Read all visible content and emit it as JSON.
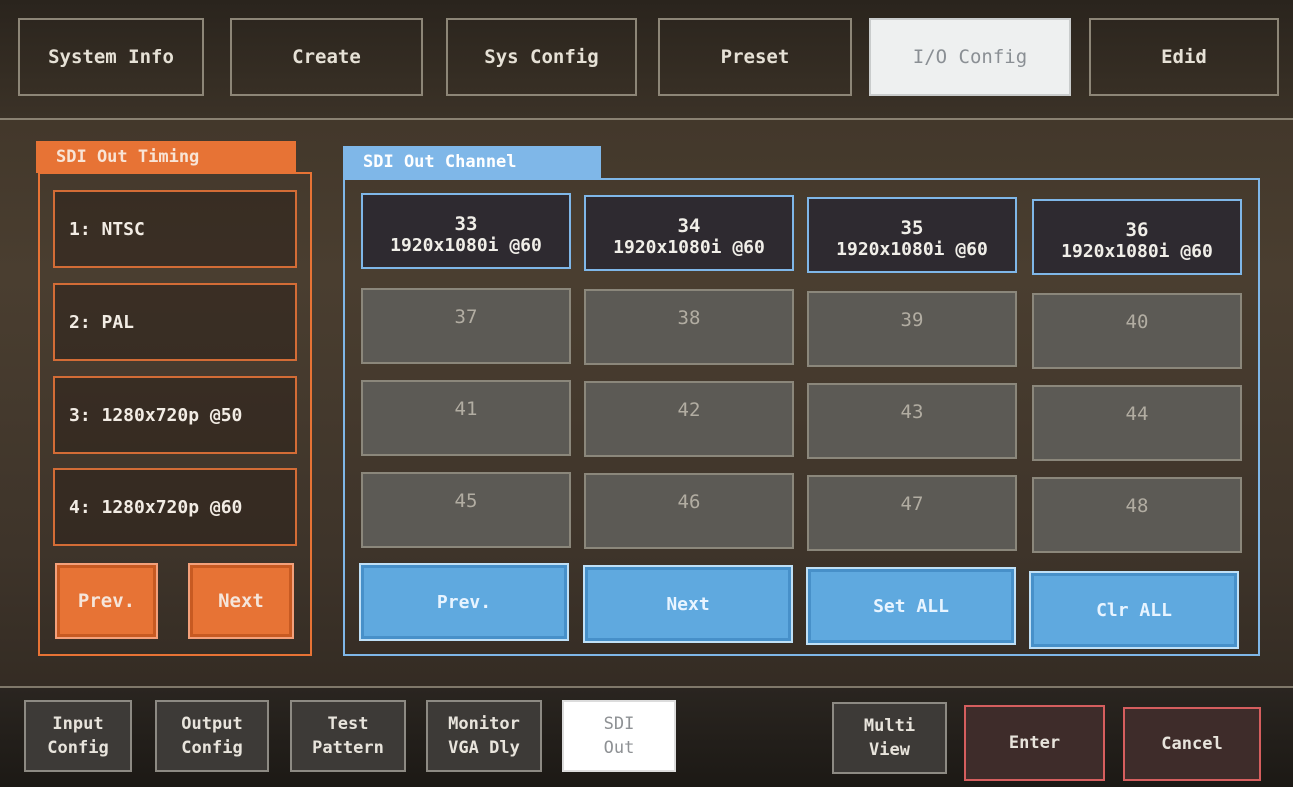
{
  "top_tabs": [
    {
      "label": "System Info"
    },
    {
      "label": "Create"
    },
    {
      "label": "Sys Config"
    },
    {
      "label": "Preset"
    },
    {
      "label": "I/O Config",
      "active": true
    },
    {
      "label": "Edid"
    }
  ],
  "sdi_out_timing": {
    "title": "SDI Out Timing",
    "items": [
      {
        "label": "1: NTSC"
      },
      {
        "label": "2: PAL"
      },
      {
        "label": "3: 1280x720p @50"
      },
      {
        "label": "4: 1280x720p @60"
      }
    ],
    "prev_label": "Prev.",
    "next_label": "Next"
  },
  "sdi_out_channel": {
    "title": "SDI Out Channel",
    "channels": [
      {
        "num": "33",
        "res": "1920x1080i @60"
      },
      {
        "num": "34",
        "res": "1920x1080i @60"
      },
      {
        "num": "35",
        "res": "1920x1080i @60"
      },
      {
        "num": "36",
        "res": "1920x1080i @60"
      },
      {
        "num": "37"
      },
      {
        "num": "38"
      },
      {
        "num": "39"
      },
      {
        "num": "40"
      },
      {
        "num": "41"
      },
      {
        "num": "42"
      },
      {
        "num": "43"
      },
      {
        "num": "44"
      },
      {
        "num": "45"
      },
      {
        "num": "46"
      },
      {
        "num": "47"
      },
      {
        "num": "48"
      }
    ],
    "buttons": {
      "prev_label": "Prev.",
      "next_label": "Next",
      "set_all_label": "Set ALL",
      "clr_all_label": "Clr ALL"
    }
  },
  "bottom_bar": {
    "input_config": [
      "Input",
      "Config"
    ],
    "output_config": [
      "Output",
      "Config"
    ],
    "test_pattern": [
      "Test",
      "Pattern"
    ],
    "monitor_vga": [
      "Monitor",
      "VGA Dly"
    ],
    "sdi_out": [
      "SDI",
      "Out"
    ],
    "multi_view": [
      "Multi",
      "View"
    ],
    "enter_label": "Enter",
    "cancel_label": "Cancel"
  },
  "colors": {
    "accent_orange": "#e77335",
    "accent_blue": "#7fb7e8"
  }
}
